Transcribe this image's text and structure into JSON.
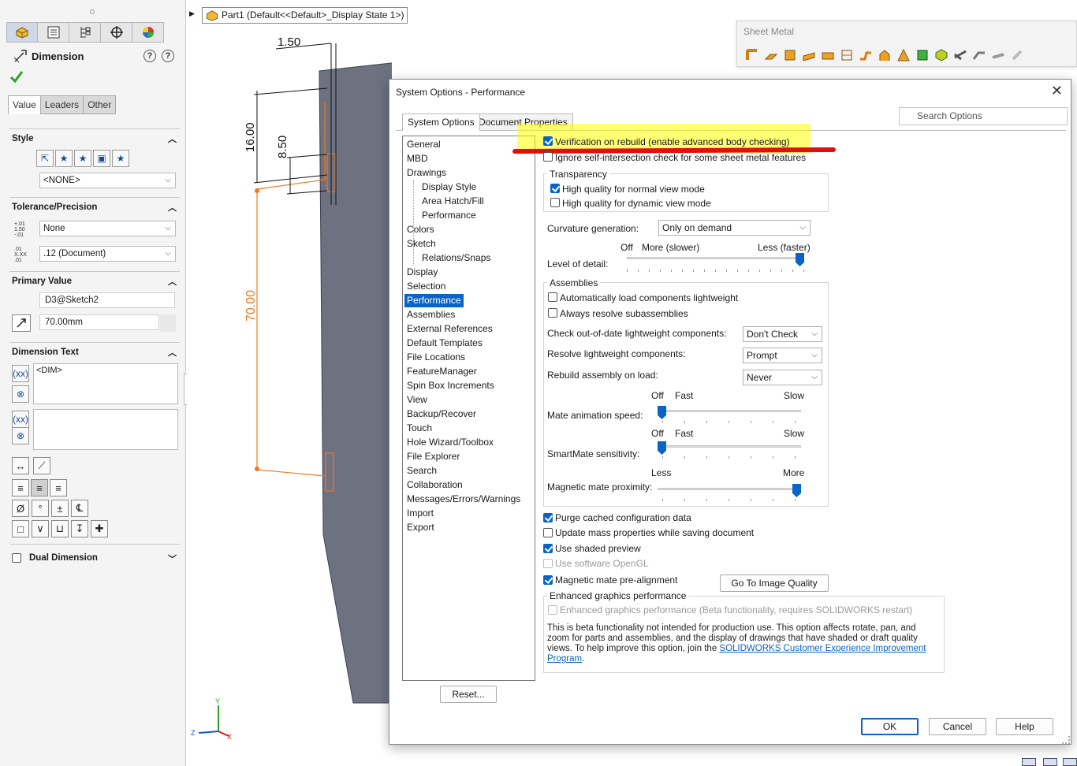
{
  "breadcrumb": {
    "text": "Part1  (Default<<Default>_Display State 1>)"
  },
  "property_manager": {
    "title": "Dimension",
    "tabs": [
      "Value",
      "Leaders",
      "Other"
    ],
    "style": {
      "header": "Style",
      "dropdown": "<NONE>"
    },
    "tolerance": {
      "header": "Tolerance/Precision",
      "tolerance_value": "None",
      "precision_value": ".12 (Document)"
    },
    "primary_value": {
      "header": "Primary Value",
      "reference": "D3@Sketch2",
      "value": "70.00mm"
    },
    "dimension_text": {
      "header": "Dimension Text",
      "text": "<DIM>"
    },
    "dual_dimension": {
      "label": "Dual Dimension"
    }
  },
  "sketch": {
    "dims": {
      "d1": "1.50",
      "d2": "16.00",
      "d3": "8.50",
      "d4": "70.00"
    },
    "axes": {
      "y": "Y",
      "x": "X",
      "z": "Z"
    }
  },
  "sheet_metal_toolbar": {
    "title": "Sheet Metal"
  },
  "dialog": {
    "title": "System Options - Performance",
    "tabs": {
      "system": "System Options",
      "document": "Document Properties"
    },
    "search_placeholder": "Search Options",
    "tree": {
      "general": "General",
      "mbd": "MBD",
      "drawings": "Drawings",
      "display_style": "Display Style",
      "area_hatch": "Area Hatch/Fill",
      "performance_sub": "Performance",
      "colors": "Colors",
      "sketch": "Sketch",
      "relations": "Relations/Snaps",
      "display": "Display",
      "selection": "Selection",
      "performance": "Performance",
      "assemblies": "Assemblies",
      "external_refs": "External References",
      "default_templates": "Default Templates",
      "file_locations": "File Locations",
      "feature_manager": "FeatureManager",
      "spin_box": "Spin Box Increments",
      "view": "View",
      "backup": "Backup/Recover",
      "touch": "Touch",
      "hole_wizard": "Hole Wizard/Toolbox",
      "file_explorer": "File Explorer",
      "search": "Search",
      "collaboration": "Collaboration",
      "messages": "Messages/Errors/Warnings",
      "import": "Import",
      "export": "Export"
    },
    "reset_button": "Reset...",
    "verification": "Verification on rebuild (enable advanced body checking)",
    "ignore_self_intersection": "Ignore self-intersection check for some sheet metal features",
    "transparency": {
      "title": "Transparency",
      "normal": "High quality for normal view mode",
      "dynamic": "High quality for dynamic view mode"
    },
    "curvature": {
      "label": "Curvature generation:",
      "value": "Only on demand"
    },
    "level_of_detail": {
      "label": "Level of detail:",
      "off": "Off",
      "more": "More (slower)",
      "less": "Less (faster)",
      "level": 1.0
    },
    "assemblies": {
      "title": "Assemblies",
      "auto_lightweight": "Automatically load components lightweight",
      "always_resolve": "Always resolve subassemblies",
      "check_outdated": {
        "label": "Check out-of-date lightweight components:",
        "value": "Don't Check"
      },
      "resolve_lightweight": {
        "label": "Resolve lightweight components:",
        "value": "Prompt"
      },
      "rebuild_on_load": {
        "label": "Rebuild assembly on load:",
        "value": "Never"
      },
      "mate_animation": {
        "label": "Mate animation speed:",
        "off": "Off",
        "fast": "Fast",
        "slow": "Slow",
        "level": 0.0
      },
      "smartmate": {
        "label": "SmartMate sensitivity:",
        "off": "Off",
        "fast": "Fast",
        "slow": "Slow",
        "level": 0.0
      },
      "magnetic": {
        "label": "Magnetic mate proximity:",
        "less": "Less",
        "more": "More",
        "level": 1.0
      }
    },
    "purge_cached": "Purge cached configuration data",
    "update_mass": "Update mass properties while saving document",
    "shaded_preview": "Use shaded preview",
    "software_opengl": "Use software OpenGL",
    "magnetic_prealign": "Magnetic mate pre-alignment",
    "go_to_image_quality": "Go To Image Quality",
    "enhanced": {
      "title": "Enhanced graphics performance",
      "checkbox": "Enhanced graphics performance (Beta functionality, requires SOLIDWORKS restart)",
      "p1": "This is beta functionality not intended for production use.  This option affects rotate, pan, and",
      "p2": "zoom for parts and assemblies, and the display of drawings that have shaded or draft quality",
      "p3": "views.  To help improve this option, join the ",
      "link1": "SOLIDWORKS Customer Experience Improvement",
      "link2": "Program",
      "p4": "."
    },
    "ok": "OK",
    "cancel": "Cancel",
    "help": "Help"
  },
  "colors": {
    "accent": "#0a64c8",
    "sketch_orange": "#f07820",
    "part_gray": "#6e7180",
    "highlight_yellow": "#ffff00",
    "highlight_red": "#e01010"
  }
}
